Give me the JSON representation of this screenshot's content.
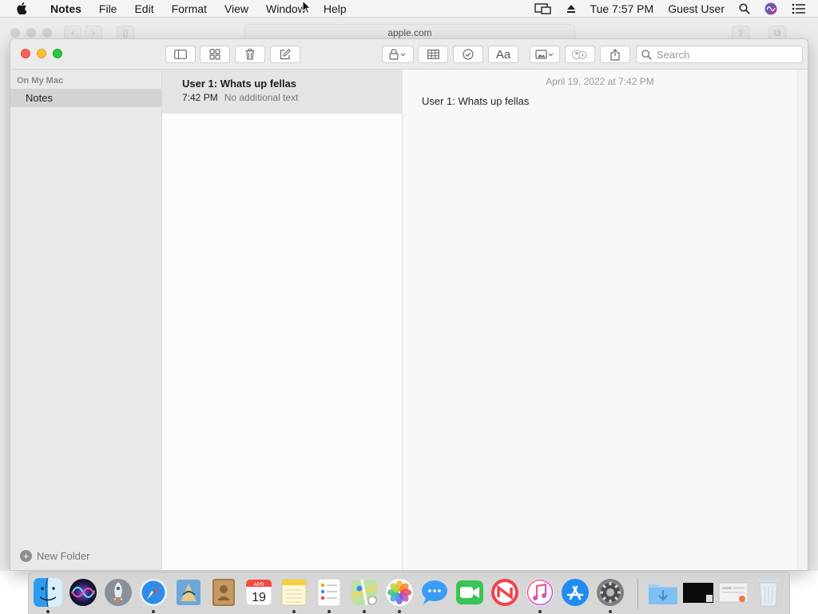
{
  "menubar": {
    "app_name": "Notes",
    "menus": [
      "File",
      "Edit",
      "Format",
      "View",
      "Window",
      "Help"
    ],
    "clock": "Tue 7:57 PM",
    "user": "Guest User"
  },
  "background_window": {
    "address": "apple.com"
  },
  "notes_window": {
    "search": {
      "placeholder": "Search",
      "value": ""
    },
    "sidebar": {
      "section_title": "On My Mac",
      "folders": [
        {
          "label": "Notes",
          "selected": true
        }
      ],
      "new_folder_label": "New Folder"
    },
    "note_list": [
      {
        "title": "User 1: Whats up fellas",
        "time": "7:42 PM",
        "preview": "No additional text",
        "selected": true
      }
    ],
    "editor": {
      "date": "April 19, 2022 at 7:42 PM",
      "body": "User 1: Whats up fellas"
    }
  },
  "dock": {
    "apps": [
      {
        "name": "finder-icon",
        "running": true
      },
      {
        "name": "siri-icon",
        "running": false
      },
      {
        "name": "launchpad-icon",
        "running": false
      },
      {
        "name": "safari-icon",
        "running": true
      },
      {
        "name": "mail-icon",
        "running": false
      },
      {
        "name": "contacts-icon",
        "running": false
      },
      {
        "name": "calendar-icon",
        "running": false,
        "month": "APR",
        "day": "19"
      },
      {
        "name": "notes-icon",
        "running": true
      },
      {
        "name": "reminders-icon",
        "running": true
      },
      {
        "name": "maps-icon",
        "running": true
      },
      {
        "name": "photos-icon",
        "running": true
      },
      {
        "name": "messages-icon",
        "running": false
      },
      {
        "name": "facetime-icon",
        "running": false
      },
      {
        "name": "news-icon",
        "running": false
      },
      {
        "name": "music-icon",
        "running": true
      },
      {
        "name": "app-store-icon",
        "running": false
      },
      {
        "name": "system-preferences-icon",
        "running": true
      },
      {
        "name": "downloads-icon",
        "running": false
      },
      {
        "name": "screenshot-folder-icon",
        "running": false
      },
      {
        "name": "documents-folder-icon",
        "running": false
      },
      {
        "name": "trash-icon",
        "running": false
      }
    ]
  },
  "colors": {
    "close": "#fe5f57",
    "minimize": "#febc2e",
    "zoom": "#28c840",
    "selected_folder": "#d3d3d3",
    "selected_note": "#e4e4e4"
  }
}
